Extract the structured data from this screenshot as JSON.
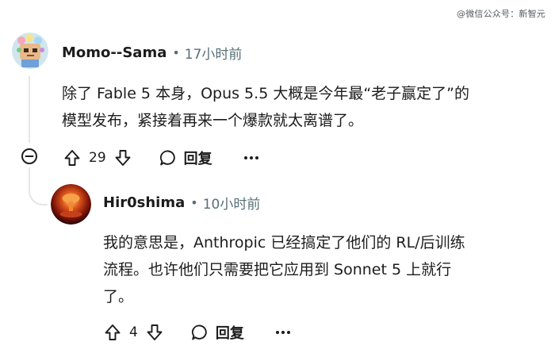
{
  "watermark": "@微信公众号：新智元",
  "comments": [
    {
      "author": "Momo--Sama",
      "separator": "•",
      "time": "17小时前",
      "lines": [
        "除了 Fable 5 本身，Opus 5.5 大概是今年最“老子赢定了”的",
        "模型发布，紧接着再来一个爆款就太离谱了。"
      ],
      "votes": "29",
      "reply_label": "回复"
    },
    {
      "author": "Hir0shima",
      "separator": "•",
      "time": "10小时前",
      "lines": [
        "我的意思是，Anthropic 已经搞定了他们的 RL/后训练",
        "流程。也许他们只需要把它应用到 Sonnet 5 上就行",
        "了。"
      ],
      "votes": "4",
      "reply_label": "回复"
    }
  ],
  "icons": {
    "upvote": "arrow-up-icon",
    "downvote": "arrow-down-icon",
    "reply": "speech-bubble-icon",
    "more": "more-horizontal-icon",
    "collapse": "minus-circle-icon"
  },
  "colors": {
    "text": "#1c1c1c",
    "meta": "#576f76",
    "thread_line": "#e4e6e8"
  }
}
